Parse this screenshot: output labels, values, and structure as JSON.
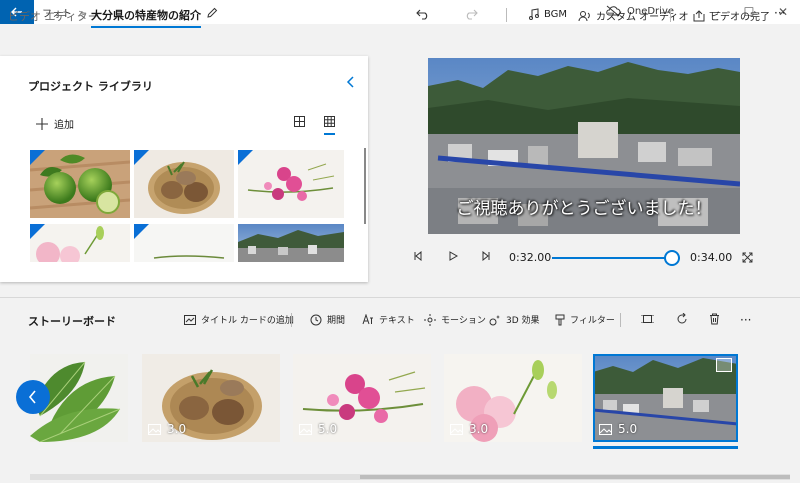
{
  "window": {
    "title": "フォト",
    "onedrive": "OneDrive"
  },
  "breadcrumb": {
    "parent": "ビデオ エディター",
    "separator": ">",
    "current": "大分県の特産物の紹介"
  },
  "toolbar": {
    "bgm": "BGM",
    "custom_audio": "カスタム オーディオ",
    "finish_video": "ビデオの完了",
    "more": "···"
  },
  "library": {
    "title": "プロジェクト ライブラリ",
    "add_label": "追加"
  },
  "preview": {
    "caption": "ご視聴ありがとうございました！"
  },
  "playback": {
    "current_time": "0:32.00",
    "total_time": "0:34.00",
    "progress": 0.94
  },
  "storyboard": {
    "title": "ストーリーボード",
    "tools": {
      "add_title_card": "タイトル カードの追加",
      "duration": "期間",
      "text": "テキスト",
      "motion": "モーション",
      "effects_3d": "3D 効果",
      "filter": "フィルター"
    },
    "clips": [
      {
        "duration": ""
      },
      {
        "duration": "3.0"
      },
      {
        "duration": "5.0"
      },
      {
        "duration": "3.0"
      },
      {
        "duration": "5.0"
      }
    ]
  },
  "colors": {
    "accent": "#0078d4",
    "titlebar_back": "#0063b1"
  }
}
